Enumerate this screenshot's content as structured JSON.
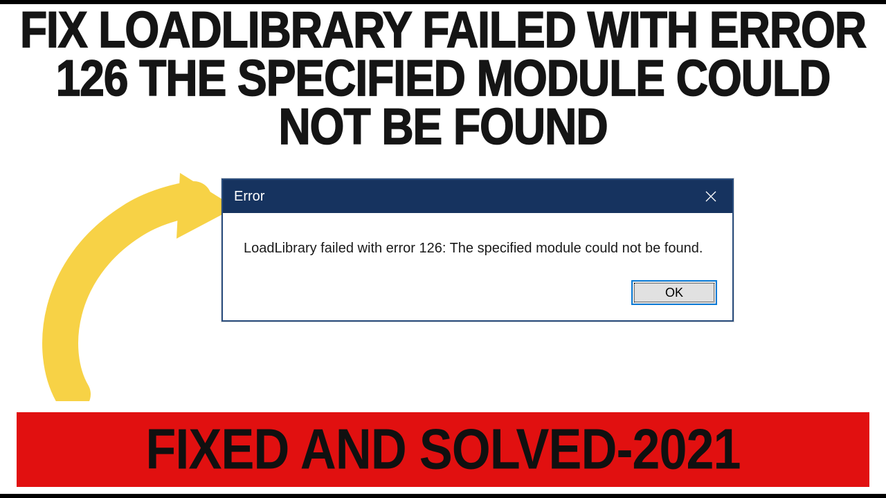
{
  "headline": "FIX LOADLIBRARY FAILED WITH ERROR 126 THE SPECIFIED MODULE COULD NOT BE FOUND",
  "dialog": {
    "title": "Error",
    "message": "LoadLibrary failed with error 126: The specified module could not be found.",
    "ok_label": "OK"
  },
  "banner": "FIXED AND SOLVED-2021",
  "colors": {
    "titlebar": "#16335f",
    "banner_bg": "#e11010",
    "arrow": "#f7d246"
  }
}
